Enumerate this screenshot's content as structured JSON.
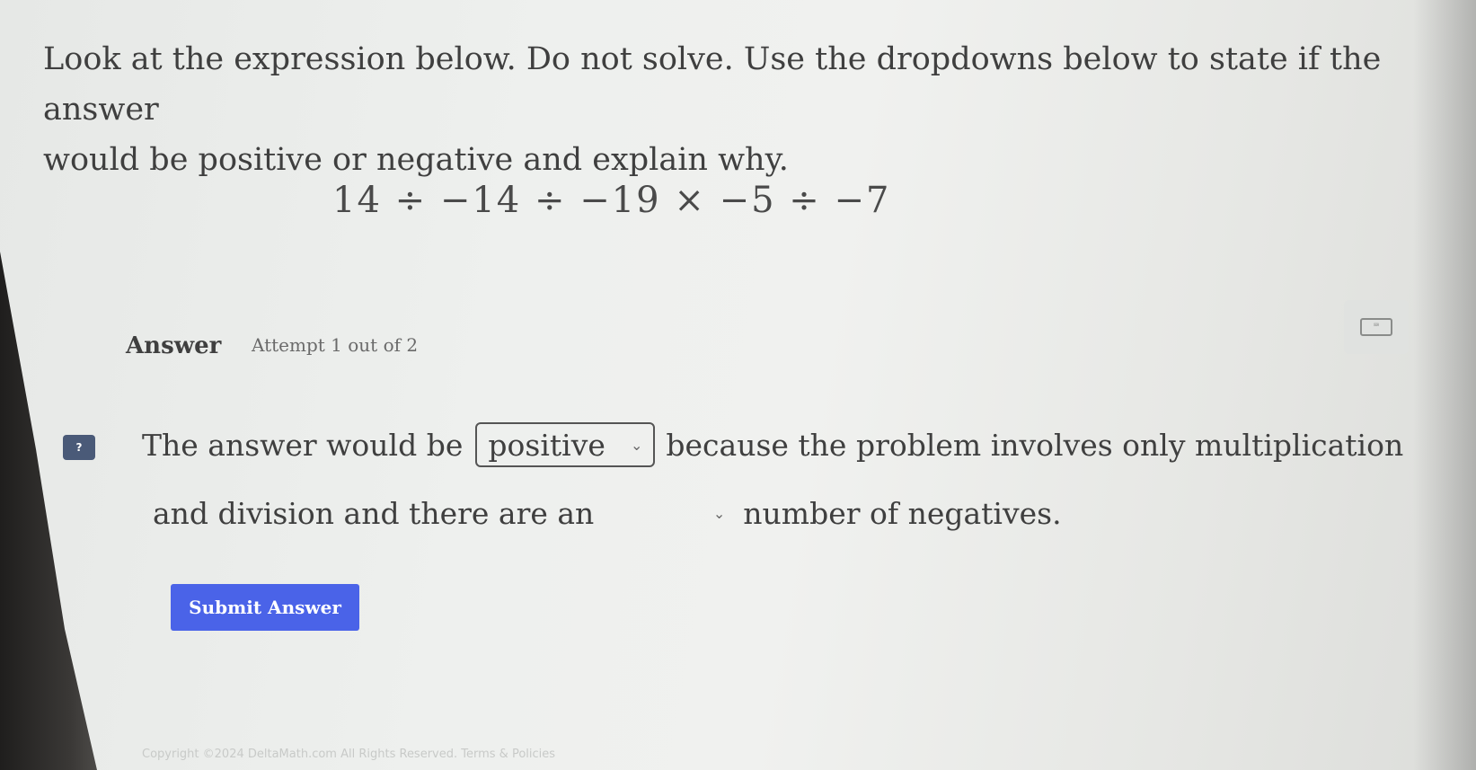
{
  "question": {
    "line1": "Look at the expression below. Do not solve. Use the dropdowns below to state if the answer",
    "line2": "would be positive or negative and explain why."
  },
  "expression": "14 ÷ −14 ÷ −19 × −5 ÷ −7",
  "answer_section": {
    "label": "Answer",
    "attempt": "Attempt 1 out of 2",
    "keyboard_icon": "keyboard-icon",
    "help_icon": "chat-help-icon",
    "help_icon_text": "?"
  },
  "sentence": {
    "part1": "The answer would be",
    "dropdown1_value": "positive",
    "part2": "because the problem involves only multiplication",
    "part3": "and division and there are an",
    "dropdown2_value": "",
    "part4": "number of negatives."
  },
  "submit_label": "Submit Answer",
  "footer": "Copyright ©2024 DeltaMath.com All Rights Reserved. Terms & Policies"
}
